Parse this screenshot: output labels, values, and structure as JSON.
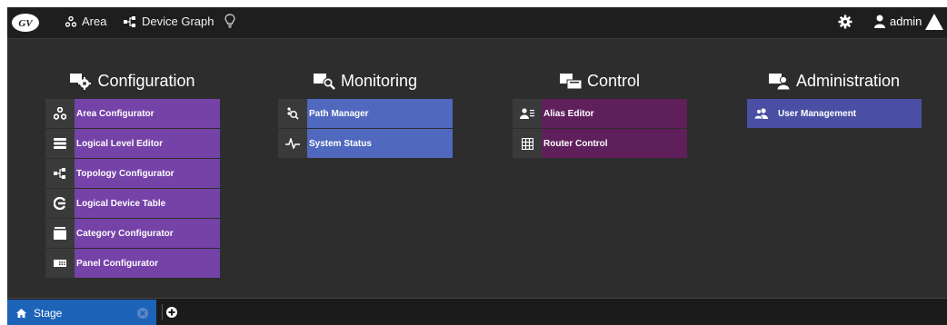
{
  "header": {
    "logo_icon": "gv-logo-icon",
    "nav": [
      {
        "label": "Area",
        "icon": "area-icon"
      },
      {
        "label": "Device Graph",
        "icon": "device-graph-icon"
      }
    ],
    "bulb_icon": "lightbulb-icon",
    "user": "admin"
  },
  "categories": {
    "configuration": {
      "title": "Configuration",
      "color": "#7542a8",
      "items": [
        {
          "label": "Area Configurator",
          "icon": "area-icon"
        },
        {
          "label": "Logical Level Editor",
          "icon": "levels-icon"
        },
        {
          "label": "Topology Configurator",
          "icon": "topology-icon"
        },
        {
          "label": "Logical Device Table",
          "icon": "logical-device-icon"
        },
        {
          "label": "Category Configurator",
          "icon": "category-icon"
        },
        {
          "label": "Panel Configurator",
          "icon": "panel-icon"
        }
      ]
    },
    "monitoring": {
      "title": "Monitoring",
      "color": "#5069be",
      "items": [
        {
          "label": "Path Manager",
          "icon": "path-manager-icon"
        },
        {
          "label": "System Status",
          "icon": "pulse-icon"
        }
      ]
    },
    "control": {
      "title": "Control",
      "color": "#5e1f5b",
      "items": [
        {
          "label": "Alias Editor",
          "icon": "alias-icon"
        },
        {
          "label": "Router Control",
          "icon": "grid-icon"
        }
      ]
    },
    "administration": {
      "title": "Administration",
      "color": "#4a4fa4",
      "items": [
        {
          "label": "User Management",
          "icon": "users-icon"
        }
      ]
    }
  },
  "tabs": [
    {
      "label": "Stage",
      "icon": "home-icon",
      "active": true
    }
  ]
}
